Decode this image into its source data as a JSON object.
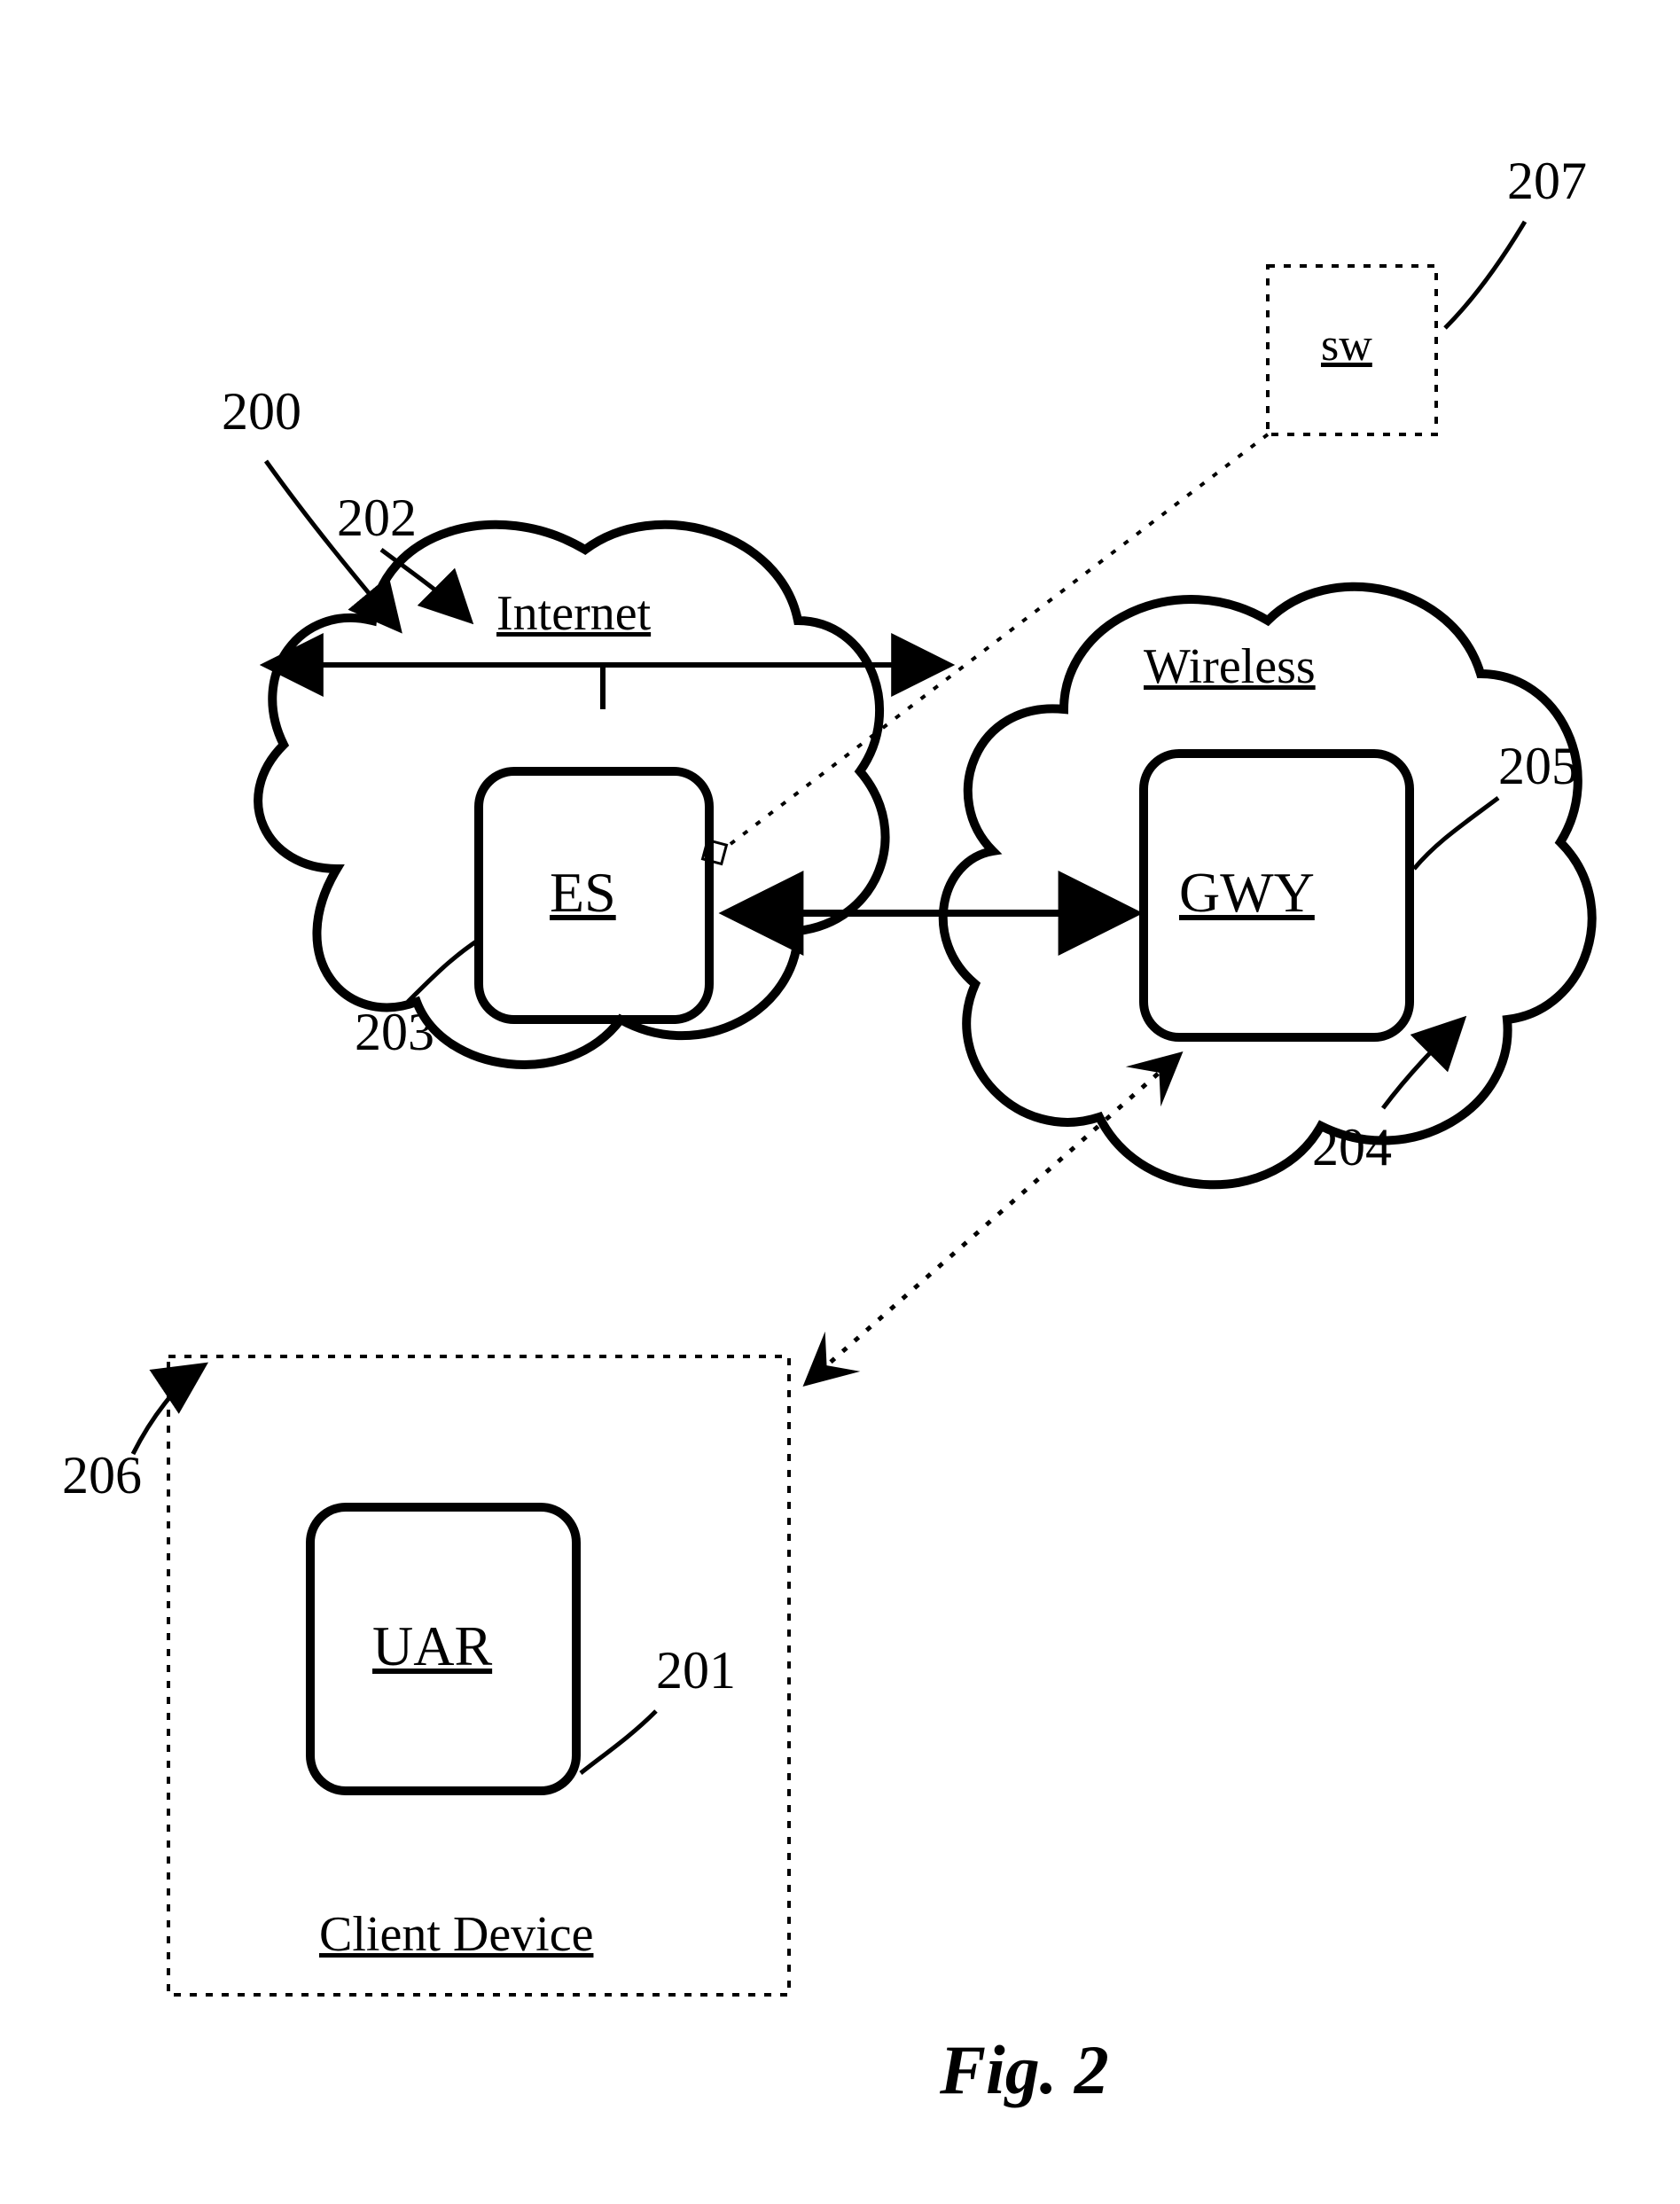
{
  "figure_label": "Fig. 2",
  "refs": {
    "overall": "200",
    "internet_cloud": "202",
    "es_box": "203",
    "wireless_cloud": "204",
    "gwy_box": "205",
    "client_device": "206",
    "uar_box": "201",
    "sw_box": "207"
  },
  "nodes": {
    "internet": {
      "title": "Internet",
      "box": "ES"
    },
    "wireless": {
      "title": "Wireless",
      "box": "GWY"
    },
    "client": {
      "title": "Client Device",
      "box": "UAR"
    },
    "sw": {
      "label": "sw"
    }
  }
}
